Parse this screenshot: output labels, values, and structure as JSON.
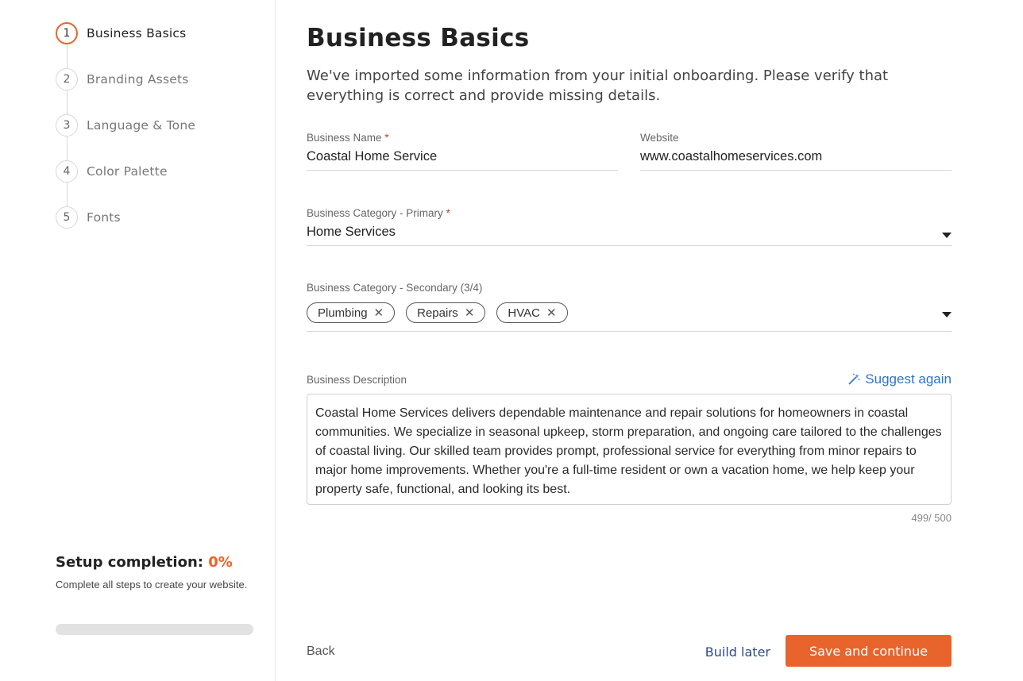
{
  "sidebar": {
    "steps": [
      {
        "number": "1",
        "label": "Business Basics"
      },
      {
        "number": "2",
        "label": "Branding Assets"
      },
      {
        "number": "3",
        "label": "Language & Tone"
      },
      {
        "number": "4",
        "label": "Color Palette"
      },
      {
        "number": "5",
        "label": "Fonts"
      }
    ],
    "active_step": 1,
    "completion": {
      "title": "Setup completion:",
      "percent_label": "0%",
      "progress_fraction": 0,
      "description": "Complete all steps to create your website."
    }
  },
  "main": {
    "title": "Business Basics",
    "subtitle": "We've imported some information from your initial onboarding. Please verify that everything is correct and provide missing details.",
    "business_name": {
      "label": "Business Name",
      "required_mark": "*",
      "value": "Coastal Home Service"
    },
    "website": {
      "label": "Website",
      "value": "www.coastalhomeservices.com"
    },
    "category_primary": {
      "label": "Business Category - Primary",
      "required_mark": "*",
      "value": "Home Services"
    },
    "category_secondary": {
      "label": "Business Category - Secondary (3/4)",
      "chips": [
        "Plumbing",
        "Repairs",
        "HVAC"
      ],
      "remove_glyph": "✕"
    },
    "description": {
      "label": "Business Description",
      "suggest_label": "Suggest again",
      "text": "Coastal Home Services delivers dependable maintenance and repair solutions for homeowners in coastal communities. We specialize in seasonal upkeep, storm preparation, and ongoing care tailored to the challenges of coastal living. Our skilled team provides prompt, professional service for everything from minor repairs to major home improvements. Whether you're a full-time resident or own a vacation home, we help keep your property safe, functional, and looking its best.",
      "char_count": "499/ 500"
    }
  },
  "footer": {
    "back_label": "Back",
    "build_later_label": "Build later",
    "save_label": "Save and continue"
  },
  "colors": {
    "accent": "#e8642c",
    "link": "#2f74c8",
    "required": "#d9322b"
  }
}
